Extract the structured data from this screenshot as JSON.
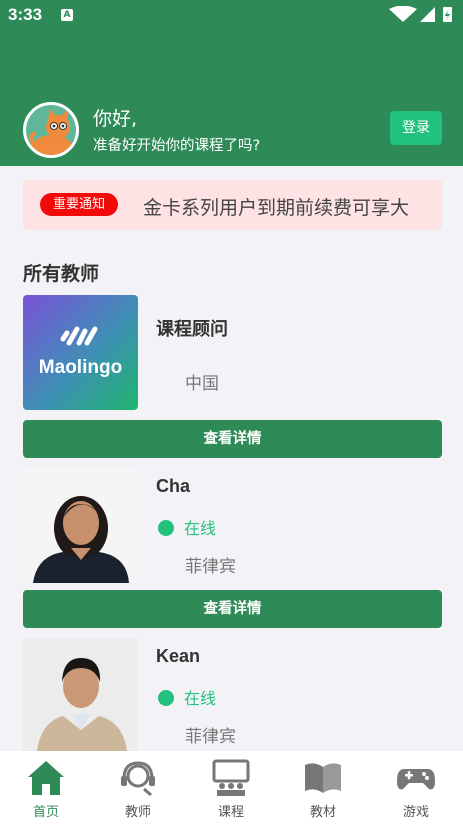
{
  "status_bar": {
    "time": "3:33",
    "notification_letter": "A"
  },
  "greeting": {
    "hello": "你好,",
    "prompt": "准备好开始你的课程了吗?",
    "login_label": "登录"
  },
  "notice": {
    "badge": "重要通知",
    "text": "金卡系列用户到期前续费可享大"
  },
  "section": {
    "title": "所有教师"
  },
  "teachers": [
    {
      "name": "课程顾问",
      "country": "中国",
      "logo_text": "Maolingo",
      "detail_label": "查看详情"
    },
    {
      "name": "Cha",
      "status": "在线",
      "country": "菲律宾",
      "detail_label": "查看详情"
    },
    {
      "name": "Kean",
      "status": "在线",
      "country": "菲律宾"
    }
  ],
  "nav": [
    {
      "label": "首页",
      "icon": "home-icon",
      "active": true
    },
    {
      "label": "教师",
      "icon": "teacher-headset-icon"
    },
    {
      "label": "课程",
      "icon": "classroom-icon"
    },
    {
      "label": "教材",
      "icon": "book-icon"
    },
    {
      "label": "游戏",
      "icon": "gamepad-icon"
    }
  ],
  "colors": {
    "primary": "#2e8b57",
    "accent": "#22c27e",
    "badge": "#f20909",
    "notice_bg": "#fde3e3"
  }
}
